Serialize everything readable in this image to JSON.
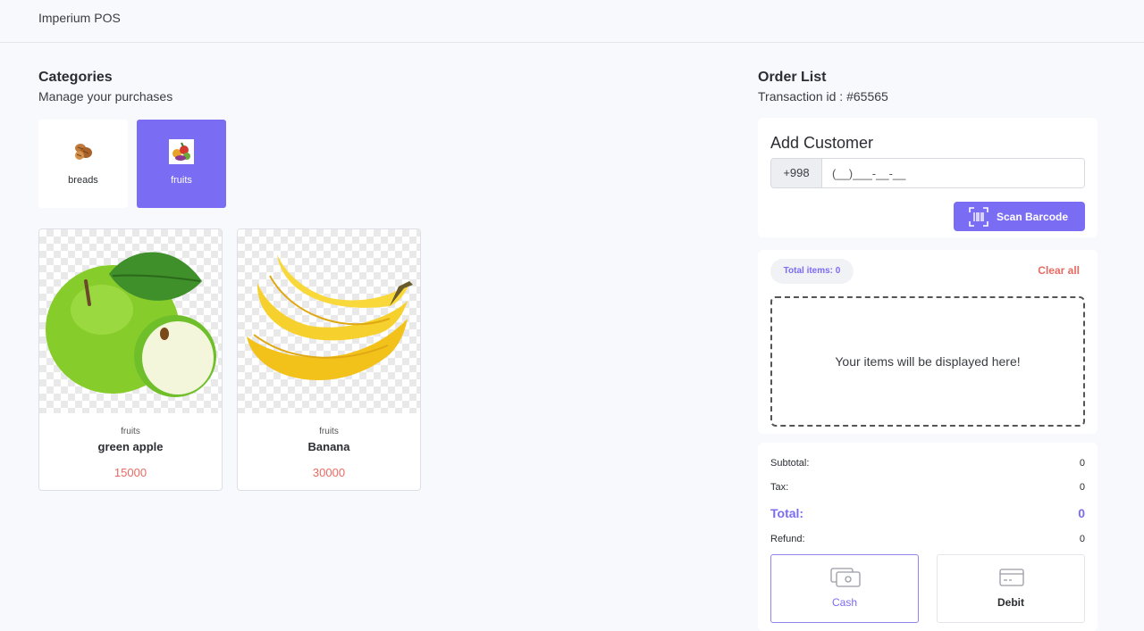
{
  "app": {
    "title": "Imperium POS"
  },
  "categories_section": {
    "title": "Categories",
    "subtitle": "Manage your purchases"
  },
  "categories": [
    {
      "label": "breads",
      "icon": "bread-icon",
      "active": false
    },
    {
      "label": "fruits",
      "icon": "fruits-icon",
      "active": true
    }
  ],
  "products": [
    {
      "category": "fruits",
      "name": "green apple",
      "price": "15000",
      "image": "green-apple-image"
    },
    {
      "category": "fruits",
      "name": "Banana",
      "price": "30000",
      "image": "banana-image"
    }
  ],
  "order": {
    "title": "Order List",
    "transaction": "Transaction id : #65565",
    "customer": {
      "title": "Add Customer",
      "phone_prefix": "+998",
      "phone_placeholder": "(__)___-__-__",
      "scan_label": "Scan Barcode"
    },
    "items": {
      "total_badge": "Total items: 0",
      "clear_label": "Clear all",
      "empty_text": "Your items will be displayed here!"
    },
    "totals": {
      "subtotal_label": "Subtotal:",
      "subtotal": "0",
      "tax_label": "Tax:",
      "tax": "0",
      "total_label": "Total:",
      "total": "0",
      "refund_label": "Refund:",
      "refund": "0"
    },
    "payment": [
      {
        "label": "Cash",
        "icon": "cash-icon",
        "active": true
      },
      {
        "label": "Debit",
        "icon": "card-icon",
        "active": false
      }
    ]
  },
  "colors": {
    "accent": "#7b6cf4",
    "price": "#e86a62",
    "background": "#f8f9fc"
  }
}
